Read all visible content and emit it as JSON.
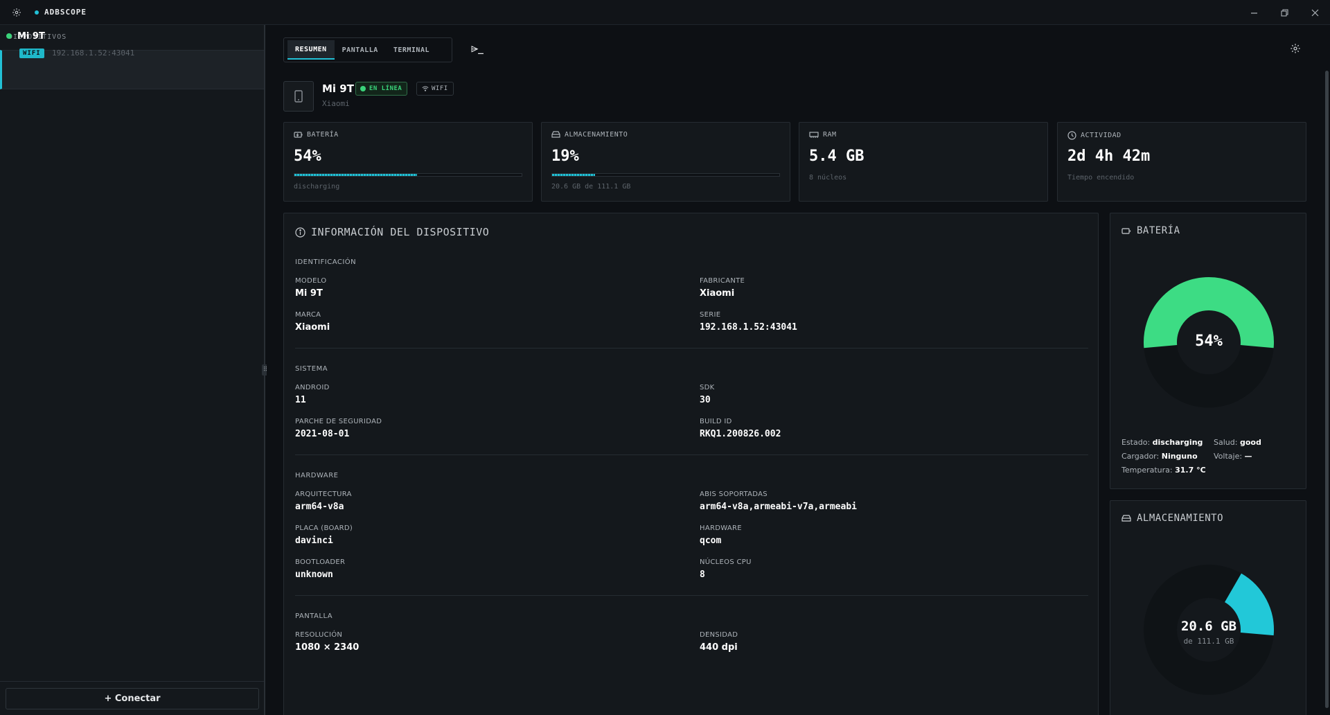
{
  "titlebar": {
    "app_name": "ADBSCOPE"
  },
  "sidebar": {
    "heading": "DISPOSITIVOS",
    "devices": [
      {
        "name": "Mi 9T",
        "badge": "WIFI",
        "address": "192.168.1.52:43041"
      }
    ],
    "connect_label": "+ Conectar"
  },
  "tabs": [
    "RESUMEN",
    "PANTALLA",
    "TERMINAL"
  ],
  "terminal_icon": "⌲_",
  "device": {
    "name": "Mi 9T",
    "status": "EN LÍNEA",
    "connection": "WIFI",
    "brand": "Xiaomi"
  },
  "stats": {
    "battery": {
      "label": "BATERÍA",
      "value": "54%",
      "sub": "discharging",
      "level": 0.54
    },
    "storage": {
      "label": "ALMACENAMIENTO",
      "value": "19%",
      "sub": "20.6 GB de 111.1 GB",
      "level": 0.19
    },
    "ram": {
      "label": "RAM",
      "value": "5.4 GB",
      "sub": "8 núcleos"
    },
    "activity": {
      "label": "ACTIVIDAD",
      "value": "2d 4h 42m",
      "sub": "Tiempo encendido"
    }
  },
  "info": {
    "title": "INFORMACIÓN DEL DISPOSITIVO",
    "identification": {
      "heading": "IDENTIFICACIÓN",
      "model_label": "MODELO",
      "model": "Mi 9T",
      "manufacturer_label": "FABRICANTE",
      "manufacturer": "Xiaomi",
      "brand_label": "MARCA",
      "brand": "Xiaomi",
      "serial_label": "SERIE",
      "serial": "192.168.1.52:43041"
    },
    "system": {
      "heading": "SISTEMA",
      "android_label": "ANDROID",
      "android": "11",
      "sdk_label": "SDK",
      "sdk": "30",
      "patch_label": "PARCHE DE SEGURIDAD",
      "patch": "2021-08-01",
      "build_label": "BUILD ID",
      "build": "RKQ1.200826.002"
    },
    "hardware": {
      "heading": "HARDWARE",
      "arch_label": "ARQUITECTURA",
      "arch": "arm64-v8a",
      "abis_label": "ABIS SOPORTADAS",
      "abis": "arm64-v8a,armeabi-v7a,armeabi",
      "board_label": "PLACA (BOARD)",
      "board": "davinci",
      "hardware_label": "HARDWARE",
      "hardware": "qcom",
      "bootloader_label": "BOOTLOADER",
      "bootloader": "unknown",
      "cores_label": "NÚCLEOS CPU",
      "cores": "8"
    },
    "screen": {
      "heading": "PANTALLA",
      "resolution_label": "RESOLUCIÓN",
      "resolution": "1080 × 2340",
      "density_label": "DENSIDAD",
      "density": "440 dpi"
    }
  },
  "battery_card": {
    "title": "BATERÍA",
    "percent_label": "54%",
    "level": 0.54,
    "state_label": "Estado:",
    "state": "discharging",
    "health_label": "Salud:",
    "health": "good",
    "charger_label": "Cargador:",
    "charger": "Ninguno",
    "voltage_label": "Voltaje:",
    "voltage": "—",
    "temp_label": "Temperatura:",
    "temp": "31.7 °C"
  },
  "storage_card": {
    "title": "ALMACENAMIENTO",
    "used": "20.6 GB",
    "total": "de 111.1 GB",
    "level": 0.19
  },
  "colors": {
    "accent": "#22c1d6",
    "online": "#3ad37a",
    "battery_gauge": "#3ddc84",
    "background": "#0d1014"
  }
}
